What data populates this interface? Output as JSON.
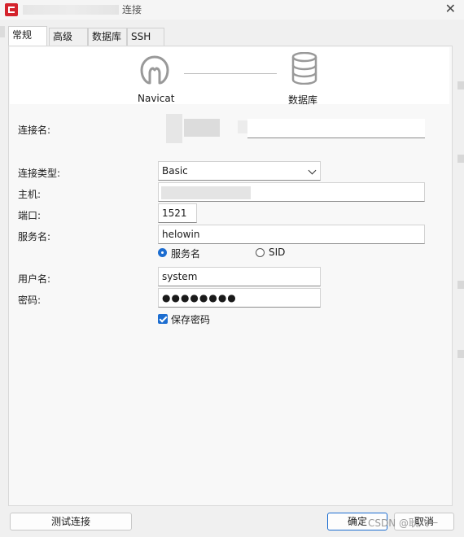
{
  "window": {
    "title": "连接",
    "close_glyph": "✕"
  },
  "tabs": [
    {
      "label": "常规",
      "active": true
    },
    {
      "label": "高级",
      "active": false
    },
    {
      "label": "数据库",
      "active": false
    },
    {
      "label": "SSH",
      "active": false
    }
  ],
  "banner": {
    "client_label": "Navicat",
    "server_label": "数据库"
  },
  "form": {
    "connection_name": {
      "label": "连接名:",
      "value": ""
    },
    "connection_type": {
      "label": "连接类型:",
      "value": "Basic"
    },
    "host": {
      "label": "主机:",
      "value": ""
    },
    "port": {
      "label": "端口:",
      "value": "1521"
    },
    "service_name": {
      "label": "服务名:",
      "value": "helowin"
    },
    "service_mode": {
      "service_name_option": "服务名",
      "sid_option": "SID",
      "selected": "服务名"
    },
    "username": {
      "label": "用户名:",
      "value": "system"
    },
    "password": {
      "label": "密码:",
      "value": "●●●●●●●●"
    },
    "save_password": {
      "label": "保存密码",
      "checked": true
    }
  },
  "footer": {
    "test_button": "测试连接",
    "ok_button": "确定",
    "cancel_button": "取消"
  },
  "watermark": "CSDN @耿八一",
  "icons": [
    "navicat-logo-icon",
    "database-icon",
    "chevron-down-icon",
    "close-icon"
  ],
  "colors": {
    "accent": "#1c6dd0",
    "brand": "#d4232c"
  }
}
